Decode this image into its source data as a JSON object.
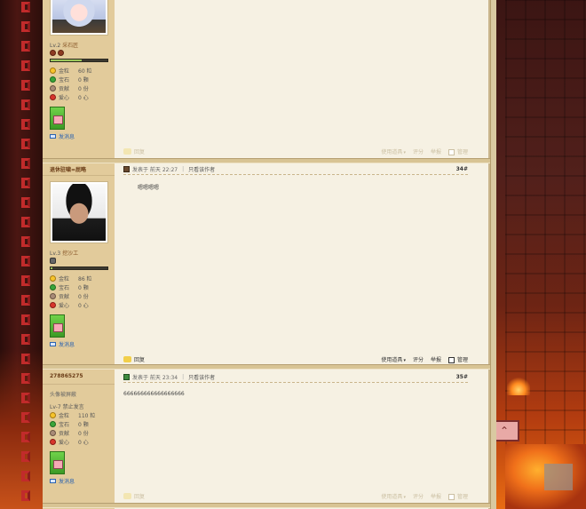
{
  "posts": [
    {
      "user": {
        "name": "",
        "level": "Lv.2",
        "title": "采石匠",
        "medal_count": 2,
        "exp_fraction": 0.55,
        "stats": [
          {
            "label": "金粒",
            "value": "60 粒"
          },
          {
            "label": "宝石",
            "value": "0 颗"
          },
          {
            "label": "贡献",
            "value": "0 份"
          },
          {
            "label": "爱心",
            "value": "0 心"
          }
        ],
        "send_message": "发消息"
      },
      "actions": {
        "reply": "回复",
        "use_tool": "使用道具",
        "rate": "评分",
        "report": "举报",
        "manage": "管理"
      }
    },
    {
      "user": {
        "name": "退休驻啸=屁略",
        "level": "Lv.3",
        "title": "挖沙工",
        "medal_count": 1,
        "exp_fraction": 0.03,
        "stats": [
          {
            "label": "金粒",
            "value": "86 粒"
          },
          {
            "label": "宝石",
            "value": "0 颗"
          },
          {
            "label": "贡献",
            "value": "0 份"
          },
          {
            "label": "爱心",
            "value": "0 心"
          }
        ],
        "send_message": "发消息"
      },
      "meta": {
        "posted_at": "发表于 前天 22:27",
        "only_author": "只看该作者",
        "floor": "34#"
      },
      "content": "嗯嗯嗯嗯",
      "actions": {
        "reply": "回复",
        "use_tool": "使用道具",
        "rate": "评分",
        "report": "举报",
        "manage": "管理"
      }
    },
    {
      "user": {
        "name": "278865275",
        "avatar_label": "头像被屏蔽",
        "level": "Lv-7",
        "title": "禁止发言",
        "stats": [
          {
            "label": "金粒",
            "value": "110 粒"
          },
          {
            "label": "宝石",
            "value": "0 颗"
          },
          {
            "label": "贡献",
            "value": "0 份"
          },
          {
            "label": "爱心",
            "value": "0 心"
          }
        ],
        "send_message": "发消息"
      },
      "meta": {
        "posted_at": "发表于 前天 23:34",
        "only_author": "只看该作者",
        "floor": "35#"
      },
      "content": "666666666666666666",
      "actions": {
        "reply": "回复",
        "use_tool": "使用道具",
        "rate": "评分",
        "report": "举报",
        "manage": "管理"
      }
    }
  ],
  "colors": {
    "content_bg": "#f6f1e3",
    "sidebar_bg": "#e2cb9b",
    "accent_brown": "#6b3d17",
    "link_blue": "#2b63b0"
  },
  "icons": {
    "back_to_top": "back-to-top-icon"
  }
}
